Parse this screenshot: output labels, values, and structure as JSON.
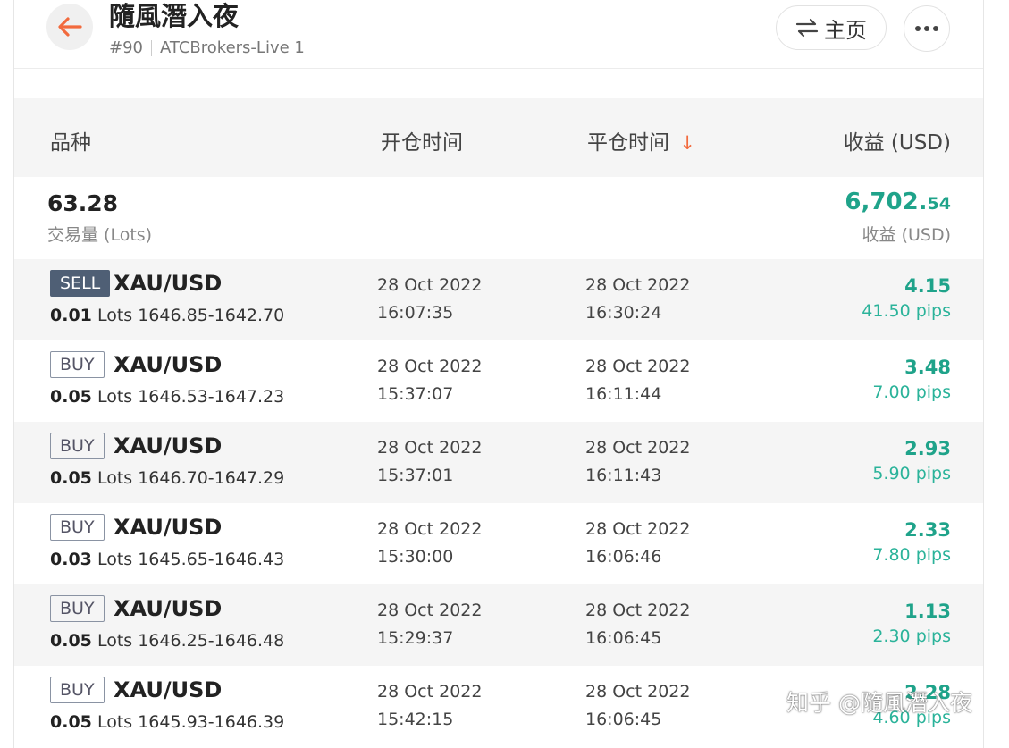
{
  "header": {
    "title": "隨風潛入夜",
    "account_number": "#90",
    "broker": "ATCBrokers-Live 1",
    "home_label": "主页",
    "home_icon": "swap-icon",
    "more_icon": "more-icon",
    "back_icon": "arrow-left-icon"
  },
  "colors": {
    "accent": "#f26a3d",
    "profit": "#1fa38a",
    "sell_badge": "#4f5f75"
  },
  "columns": {
    "symbol": "品种",
    "open_time": "开仓时间",
    "close_time": "平仓时间",
    "close_sort": "↓",
    "profit": "收益 (USD)"
  },
  "summary": {
    "volume": "63.28",
    "volume_label": "交易量 (Lots)",
    "profit_int": "6,702.",
    "profit_dec": "54",
    "profit_label": "收益 (USD)"
  },
  "trades": [
    {
      "side": "SELL",
      "symbol": "XAU/USD",
      "lots": "0.01",
      "lots_unit": "Lots",
      "range": "1646.85-1642.70",
      "open_date": "28 Oct 2022",
      "open_time": "16:07:35",
      "close_date": "28 Oct 2022",
      "close_time": "16:30:24",
      "profit": "4.15",
      "pips": "41.50 pips"
    },
    {
      "side": "BUY",
      "symbol": "XAU/USD",
      "lots": "0.05",
      "lots_unit": "Lots",
      "range": "1646.53-1647.23",
      "open_date": "28 Oct 2022",
      "open_time": "15:37:07",
      "close_date": "28 Oct 2022",
      "close_time": "16:11:44",
      "profit": "3.48",
      "pips": "7.00 pips"
    },
    {
      "side": "BUY",
      "symbol": "XAU/USD",
      "lots": "0.05",
      "lots_unit": "Lots",
      "range": "1646.70-1647.29",
      "open_date": "28 Oct 2022",
      "open_time": "15:37:01",
      "close_date": "28 Oct 2022",
      "close_time": "16:11:43",
      "profit": "2.93",
      "pips": "5.90 pips"
    },
    {
      "side": "BUY",
      "symbol": "XAU/USD",
      "lots": "0.03",
      "lots_unit": "Lots",
      "range": "1645.65-1646.43",
      "open_date": "28 Oct 2022",
      "open_time": "15:30:00",
      "close_date": "28 Oct 2022",
      "close_time": "16:06:46",
      "profit": "2.33",
      "pips": "7.80 pips"
    },
    {
      "side": "BUY",
      "symbol": "XAU/USD",
      "lots": "0.05",
      "lots_unit": "Lots",
      "range": "1646.25-1646.48",
      "open_date": "28 Oct 2022",
      "open_time": "15:29:37",
      "close_date": "28 Oct 2022",
      "close_time": "16:06:45",
      "profit": "1.13",
      "pips": "2.30 pips"
    },
    {
      "side": "BUY",
      "symbol": "XAU/USD",
      "lots": "0.05",
      "lots_unit": "Lots",
      "range": "1645.93-1646.39",
      "open_date": "28 Oct 2022",
      "open_time": "15:42:15",
      "close_date": "28 Oct 2022",
      "close_time": "16:06:45",
      "profit": "2.28",
      "pips": "4.60 pips"
    }
  ],
  "watermark": "知乎 @隨風潛入夜"
}
